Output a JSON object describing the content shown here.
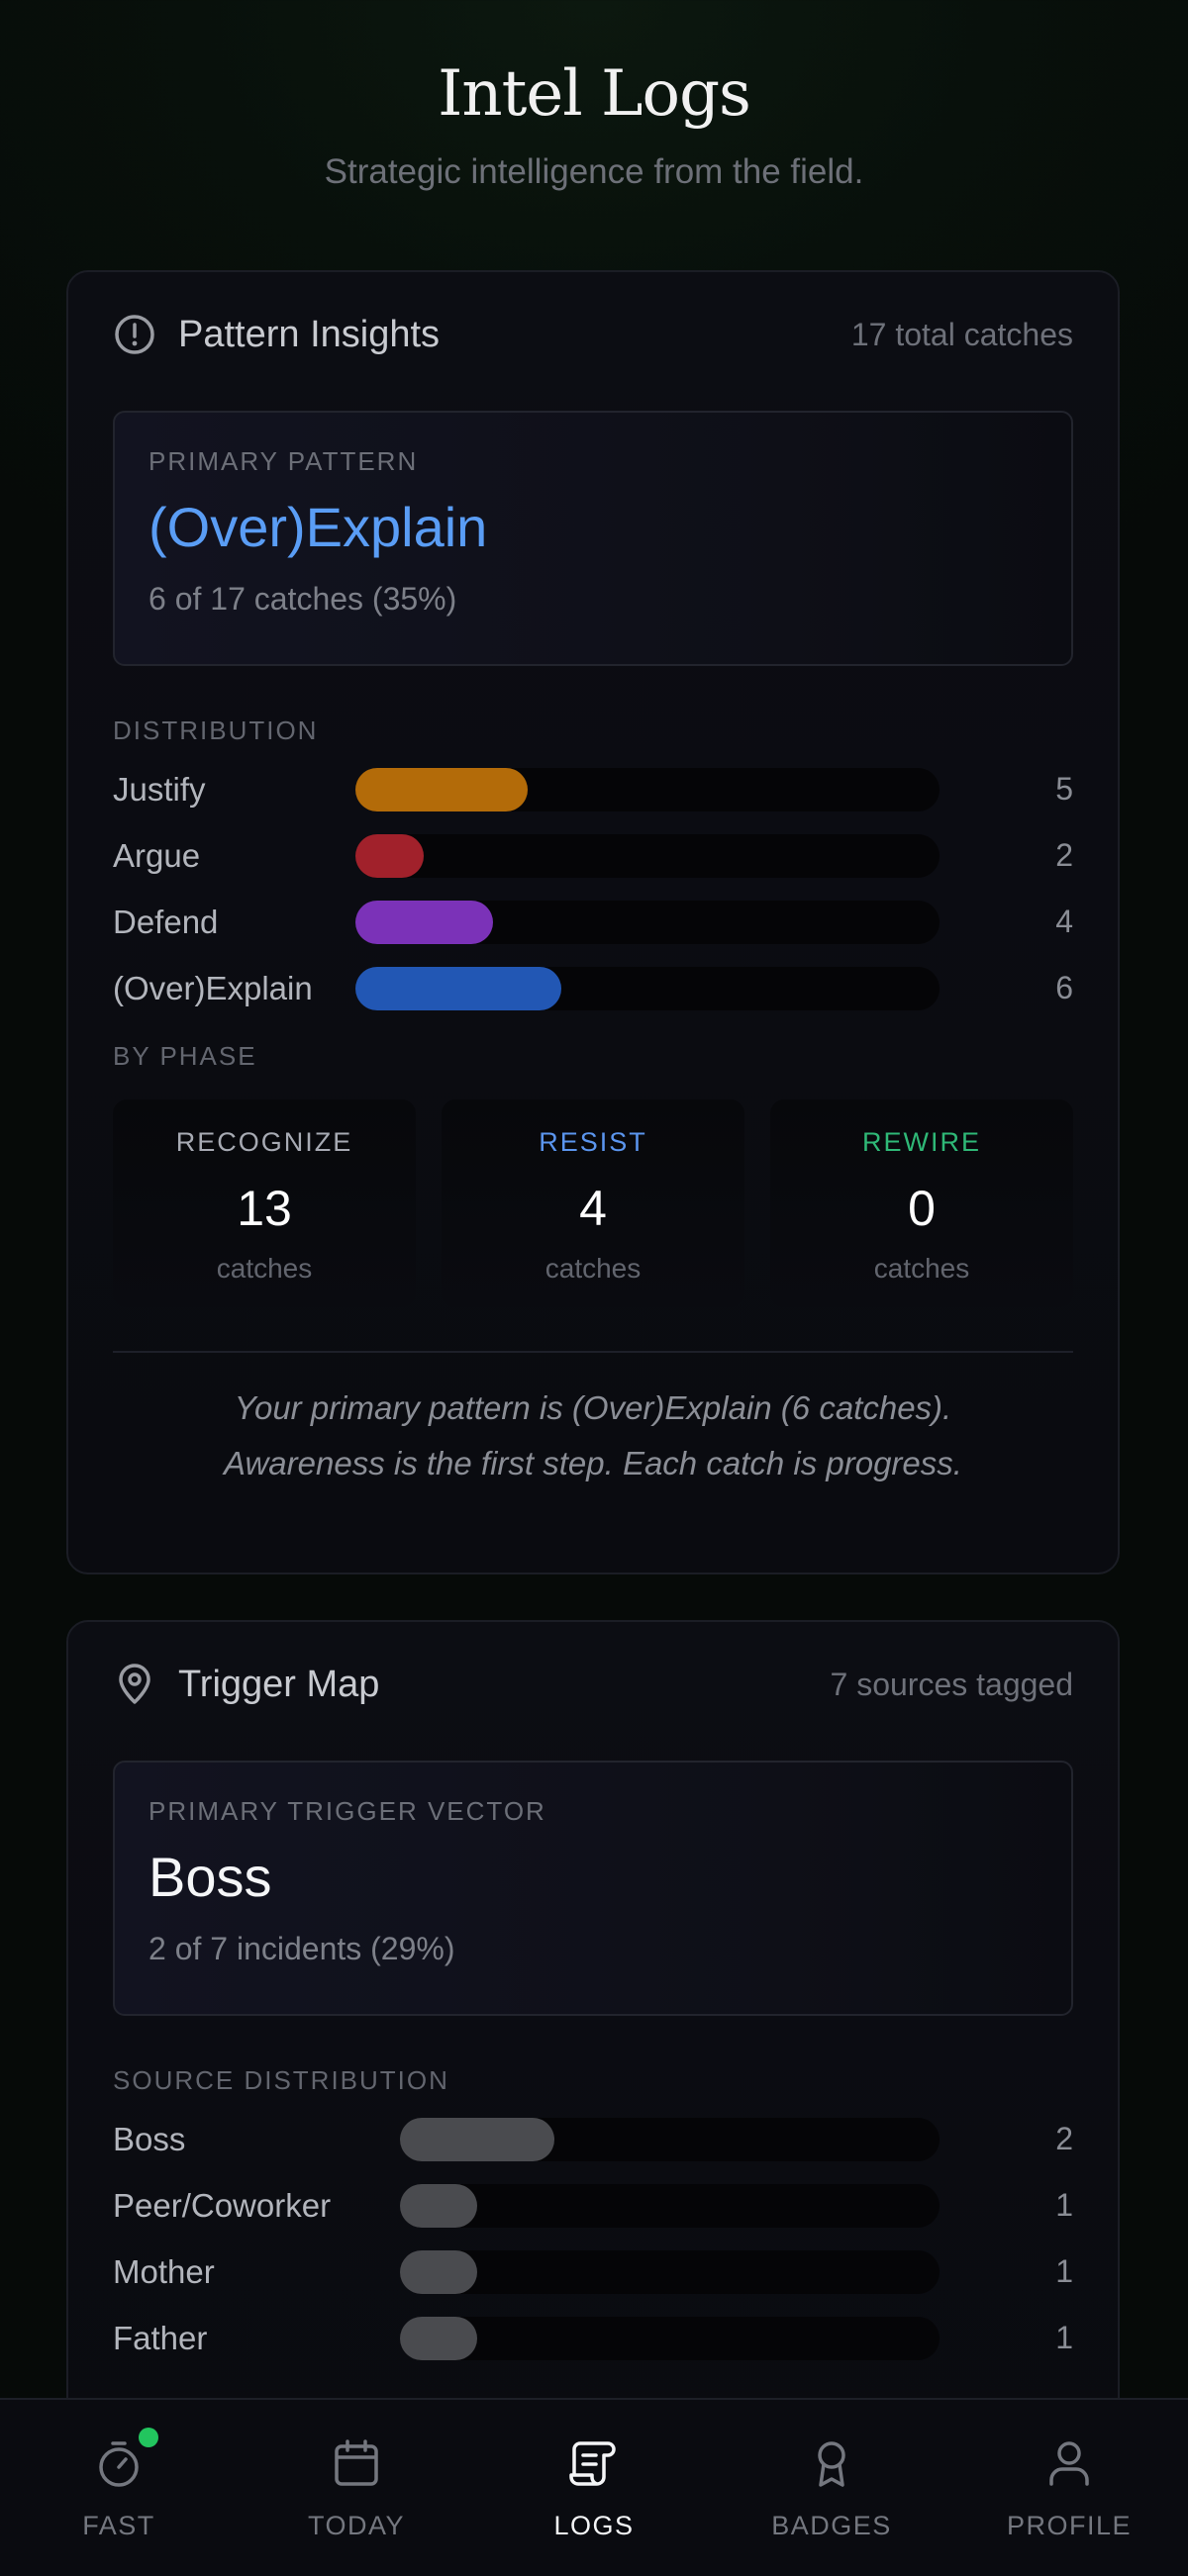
{
  "header": {
    "title": "Intel Logs",
    "subtitle": "Strategic intelligence from the field."
  },
  "pattern_insights": {
    "title": "Pattern Insights",
    "total": "17 total catches",
    "icon": "alert-circle-icon",
    "primary": {
      "label": "PRIMARY PATTERN",
      "value": "(Over)Explain",
      "detail": "6 of 17 catches (35%)"
    },
    "distribution_label": "DISTRIBUTION",
    "distribution": [
      {
        "label": "Justify",
        "value": 5,
        "value_text": "5",
        "color": "#b36b09"
      },
      {
        "label": "Argue",
        "value": 2,
        "value_text": "2",
        "color": "#a1212b"
      },
      {
        "label": "Defend",
        "value": 4,
        "value_text": "4",
        "color": "#7b32b8"
      },
      {
        "label": "(Over)Explain",
        "value": 6,
        "value_text": "6",
        "color": "#2257b4"
      }
    ],
    "phase_label": "BY PHASE",
    "phases": [
      {
        "name": "RECOGNIZE",
        "count": "13",
        "unit": "catches",
        "color": "#a7aab3"
      },
      {
        "name": "RESIST",
        "count": "4",
        "unit": "catches",
        "color": "#5b95ee"
      },
      {
        "name": "REWIRE",
        "count": "0",
        "unit": "catches",
        "color": "#2fb877"
      }
    ],
    "insight_line1": "Your primary pattern is (Over)Explain (6 catches).",
    "insight_line2": "Awareness is the first step. Each catch is progress."
  },
  "trigger_map": {
    "title": "Trigger Map",
    "total": "7 sources tagged",
    "icon": "map-pin-icon",
    "primary": {
      "label": "PRIMARY TRIGGER VECTOR",
      "value": "Boss",
      "detail": "2 of 7 incidents (29%)"
    },
    "distribution_label": "SOURCE DISTRIBUTION",
    "distribution": [
      {
        "label": "Boss",
        "value": 2,
        "value_text": "2",
        "color": "#4a4b4f"
      },
      {
        "label": "Peer/Coworker",
        "value": 1,
        "value_text": "1",
        "color": "#4a4b4f"
      },
      {
        "label": "Mother",
        "value": 1,
        "value_text": "1",
        "color": "#4a4b4f"
      },
      {
        "label": "Father",
        "value": 1,
        "value_text": "1",
        "color": "#4a4b4f"
      }
    ]
  },
  "tabbar": {
    "tabs": [
      {
        "label": "FAST",
        "icon": "stopwatch-icon",
        "active": false,
        "status_dot_color": "#22c55e"
      },
      {
        "label": "TODAY",
        "icon": "calendar-icon",
        "active": false
      },
      {
        "label": "LOGS",
        "icon": "scroll-icon",
        "active": true
      },
      {
        "label": "BADGES",
        "icon": "award-icon",
        "active": false
      },
      {
        "label": "PROFILE",
        "icon": "user-icon",
        "active": false
      }
    ]
  }
}
